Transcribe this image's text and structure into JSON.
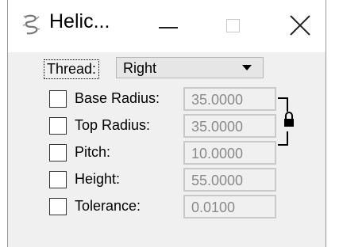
{
  "window": {
    "title": "Helic...",
    "app_icon": "helix-app-icon",
    "controls": {
      "minimize": "minimize-icon",
      "maximize": "maximize-icon",
      "close": "close-icon"
    }
  },
  "thread": {
    "label": "Thread:",
    "value": "Right"
  },
  "fields": [
    {
      "label": "Base Radius:",
      "value": "35.0000",
      "checked": false
    },
    {
      "label": "Top Radius:",
      "value": "35.0000",
      "checked": false
    },
    {
      "label": "Pitch:",
      "value": "10.0000",
      "checked": false
    },
    {
      "label": "Height:",
      "value": "55.0000",
      "checked": false
    },
    {
      "label": "Tolerance:",
      "value": "0.0100",
      "checked": false
    }
  ],
  "lock_icon": "lock-icon"
}
